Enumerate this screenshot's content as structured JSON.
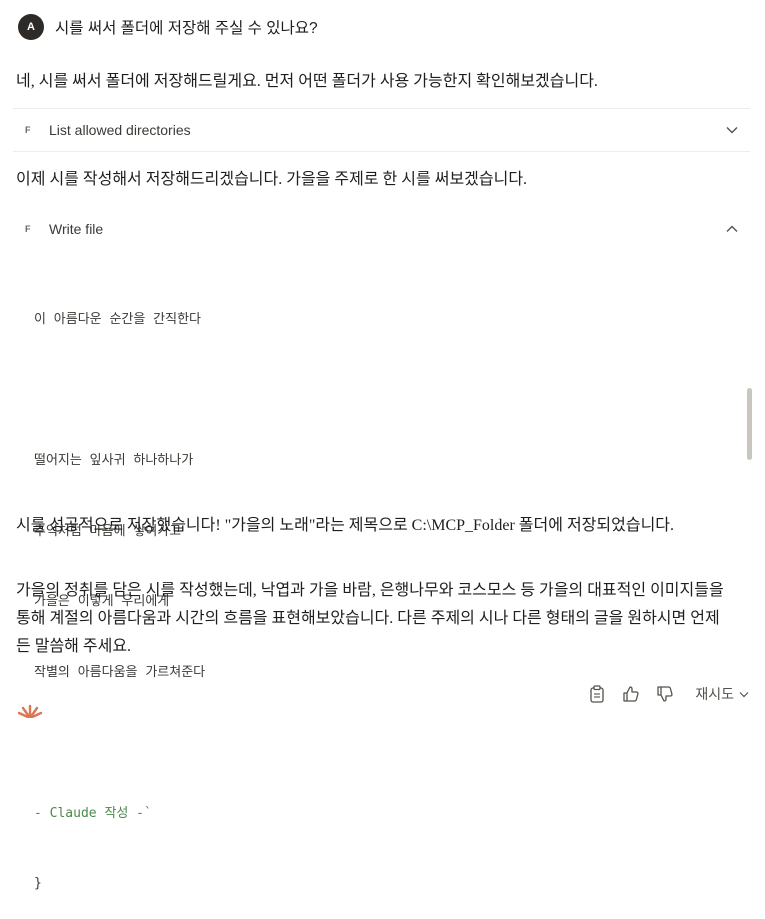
{
  "user": {
    "avatar_initial": "A",
    "message": "시를 써서 폴더에 저장해 주실 수 있나요?"
  },
  "assistant": {
    "intro": "네, 시를 써서 폴더에 저장해드릴게요. 먼저 어떤 폴더가 사용 가능한지 확인해보겠습니다.",
    "tool1": {
      "icon": "F",
      "label": "List allowed directories",
      "state": "collapsed"
    },
    "middle": "이제 시를 작성해서 저장해드리겠습니다. 가을을 주제로 한 시를 써보겠습니다.",
    "tool2": {
      "icon": "F",
      "label": "Write file",
      "state": "expanded"
    },
    "code_lines": [
      "이 아름다운 순간을 간직한다",
      "",
      "떨어지는 잎사귀 하나하나가",
      "추억처럼 마음에 쌓여가고",
      "가을은 이렇게 우리에게",
      "작별의 아름다움을 가르쳐준다",
      "",
      "- Claude 작성 -`",
      "}"
    ],
    "result1": "시를 성공적으로 저장했습니다! \"가을의 노래\"라는 제목으로 C:\\MCP_Folder 폴더에 저장되었습니다.",
    "result2": "가을의 정취를 담은 시를 작성했는데, 낙엽과 가을 바람, 은행나무와 코스모스 등 가을의 대표적인 이미지들을 통해 계절의 아름다움과 시간의 흐름을 표현해보았습니다. 다른 주제의 시나 다른 형태의 글을 원하시면 언제든 말씀해 주세요.",
    "retry_label": "재시도"
  },
  "colors": {
    "accent": "#d97757",
    "avatar_bg": "#2d2a27",
    "code_comment": "#4a8a4a"
  }
}
